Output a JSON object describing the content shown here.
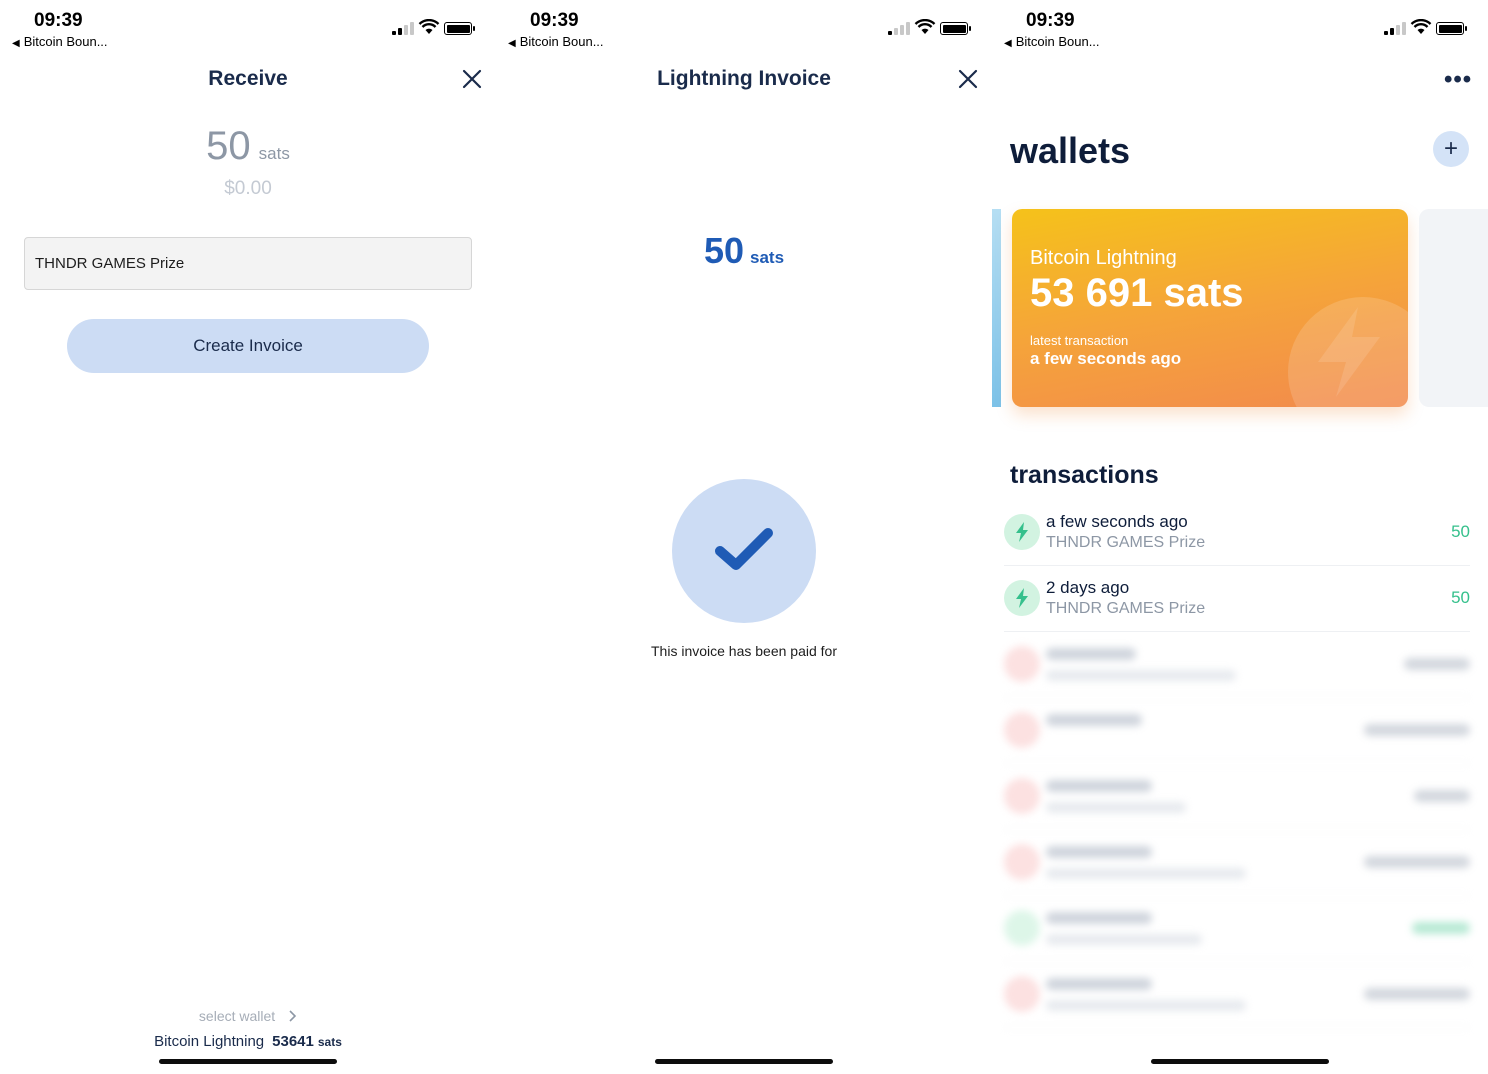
{
  "status": {
    "time": "09:39",
    "back_app": "Bitcoin Boun..."
  },
  "screen1": {
    "title": "Receive",
    "amount": "50",
    "unit": "sats",
    "fiat": "$0.00",
    "description": "THNDR GAMES Prize",
    "create_label": "Create Invoice",
    "select_wallet_label": "select wallet",
    "wallet_name": "Bitcoin Lightning",
    "wallet_balance": "53641",
    "wallet_unit": "sats"
  },
  "screen2": {
    "title": "Lightning Invoice",
    "amount": "50",
    "unit": "sats",
    "paid_text": "This invoice has been paid for"
  },
  "screen3": {
    "title": "wallets",
    "add_label": "+",
    "more_label": "•••",
    "card": {
      "label": "Bitcoin Lightning",
      "balance": "53 691 sats",
      "latest_label": "latest transaction",
      "latest_time": "a few seconds ago"
    },
    "transactions_title": "transactions",
    "transactions": [
      {
        "time": "a few seconds ago",
        "memo": "THNDR GAMES Prize",
        "value": "50"
      },
      {
        "time": "2 days ago",
        "memo": "THNDR GAMES Prize",
        "value": "50"
      }
    ]
  },
  "colors": {
    "accent": "#1f5bb5",
    "positive": "#35c08c",
    "card_top": "#f5c21a",
    "card_bottom": "#f28a4d"
  }
}
